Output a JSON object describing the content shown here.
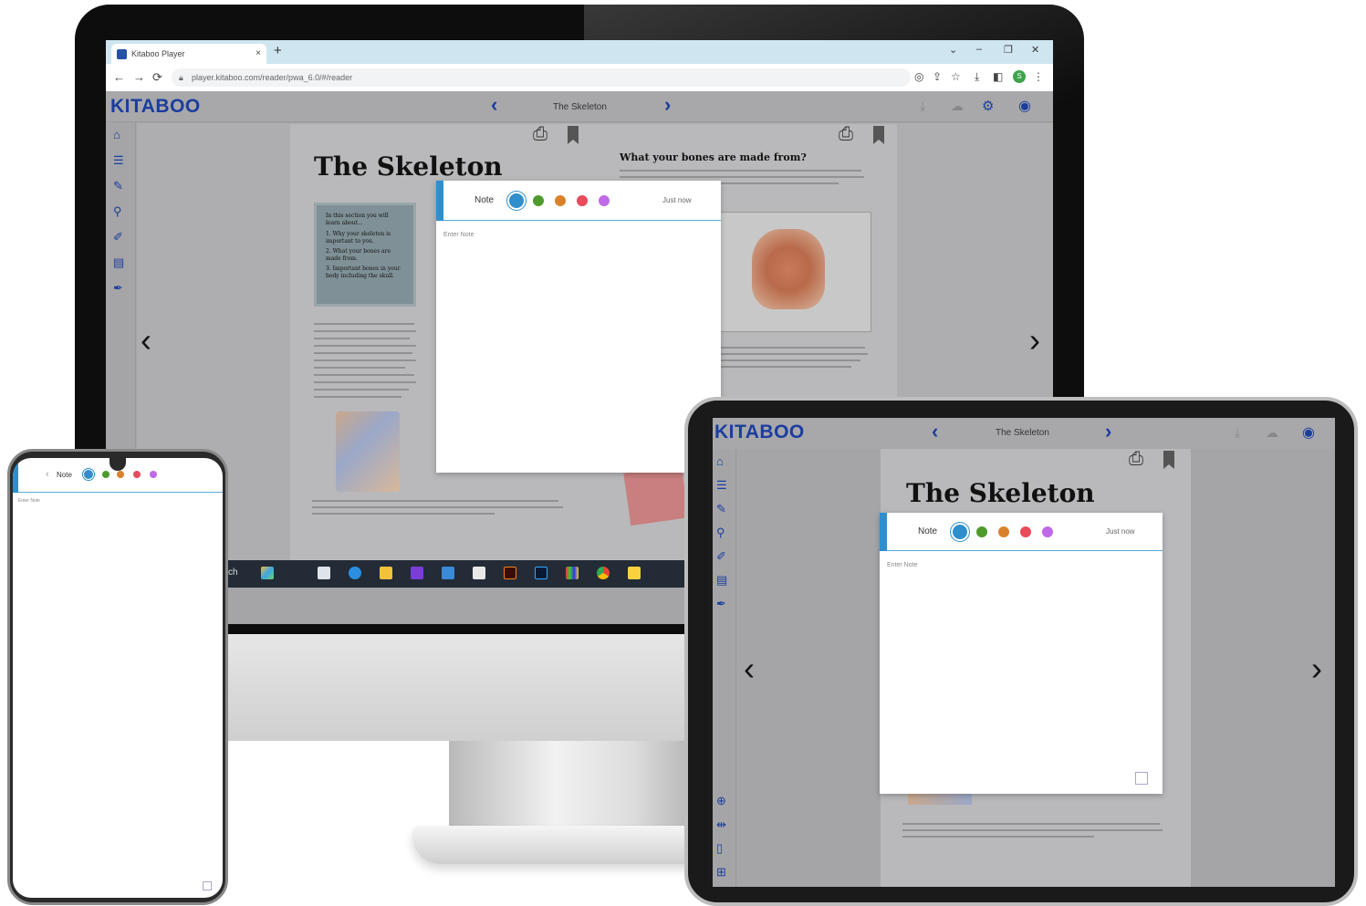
{
  "browser": {
    "tab_title": "Kitaboo Player",
    "tab_close": "×",
    "new_tab": "+",
    "url": "player.kitaboo.com/reader/pwa_6.0/#/reader",
    "window_controls": {
      "chevron": "⌄",
      "minimize": "–",
      "restore": "❐",
      "close": "✕"
    },
    "profile_initial": "S"
  },
  "app": {
    "logo": "KITABOO",
    "book_title": "The Skeleton",
    "prev": "‹",
    "next": "›",
    "page_prev": "‹",
    "page_next": "›"
  },
  "book": {
    "heading": "The Skeleton",
    "right_heading": "What your bones are made from?",
    "box_intro": "In this section you will learn about...",
    "box_items": [
      "1. Why your skeleton is important to you.",
      "2. What your bones are made from.",
      "3. Important bones in your body including the skull."
    ]
  },
  "note": {
    "label": "Note",
    "timestamp": "Just now",
    "placeholder": "Enter Note",
    "colors": [
      "#2f8fcc",
      "#4e9a2c",
      "#d9822b",
      "#e84b5a",
      "#c06ae8"
    ]
  },
  "taskbar": {
    "search_fragment": "ch"
  },
  "phone_note": {
    "back": "‹",
    "label": "Note",
    "placeholder": "Enter Note"
  }
}
